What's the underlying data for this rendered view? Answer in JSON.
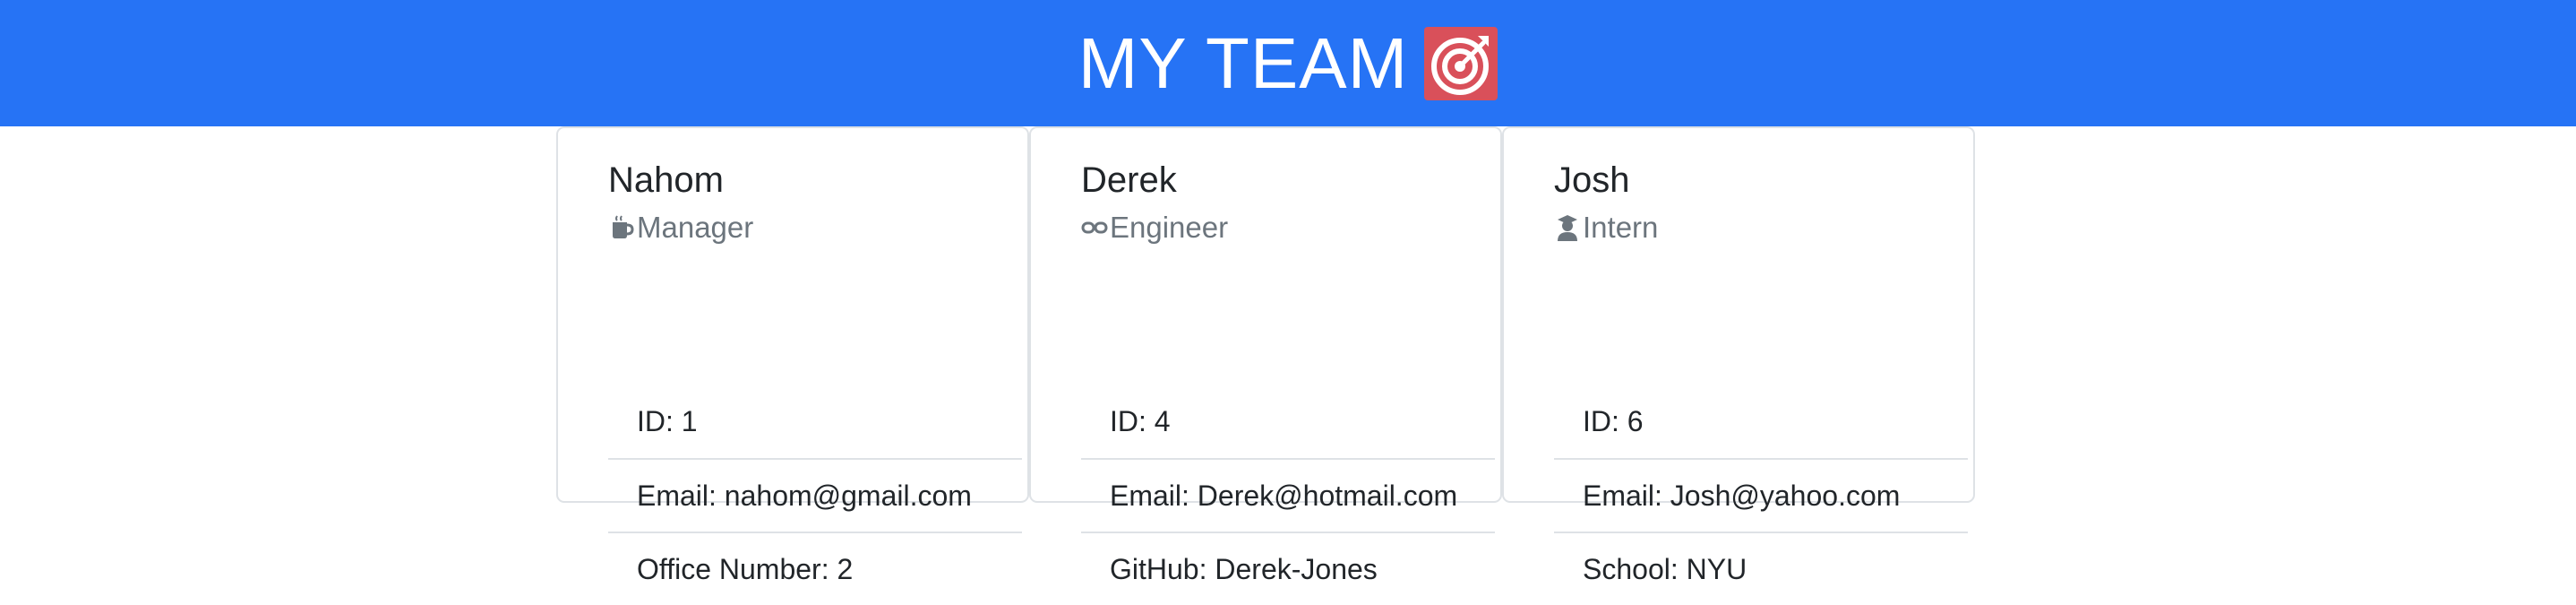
{
  "header": {
    "title": "MY TEAM",
    "icon": "target-icon",
    "background_color": "#2673f5"
  },
  "cards": [
    {
      "name": "Nahom",
      "role": "Manager",
      "role_icon": "coffee-mug-icon",
      "items": [
        "ID: 1",
        "Email: nahom@gmail.com",
        "Office Number: 2"
      ]
    },
    {
      "name": "Derek",
      "role": "Engineer",
      "role_icon": "goggles-icon",
      "items": [
        "ID: 4",
        "Email: Derek@hotmail.com",
        "GitHub: Derek-Jones"
      ]
    },
    {
      "name": "Josh",
      "role": "Intern",
      "role_icon": "student-icon",
      "items": [
        "ID: 6",
        "Email: Josh@yahoo.com",
        "School: NYU"
      ]
    }
  ]
}
